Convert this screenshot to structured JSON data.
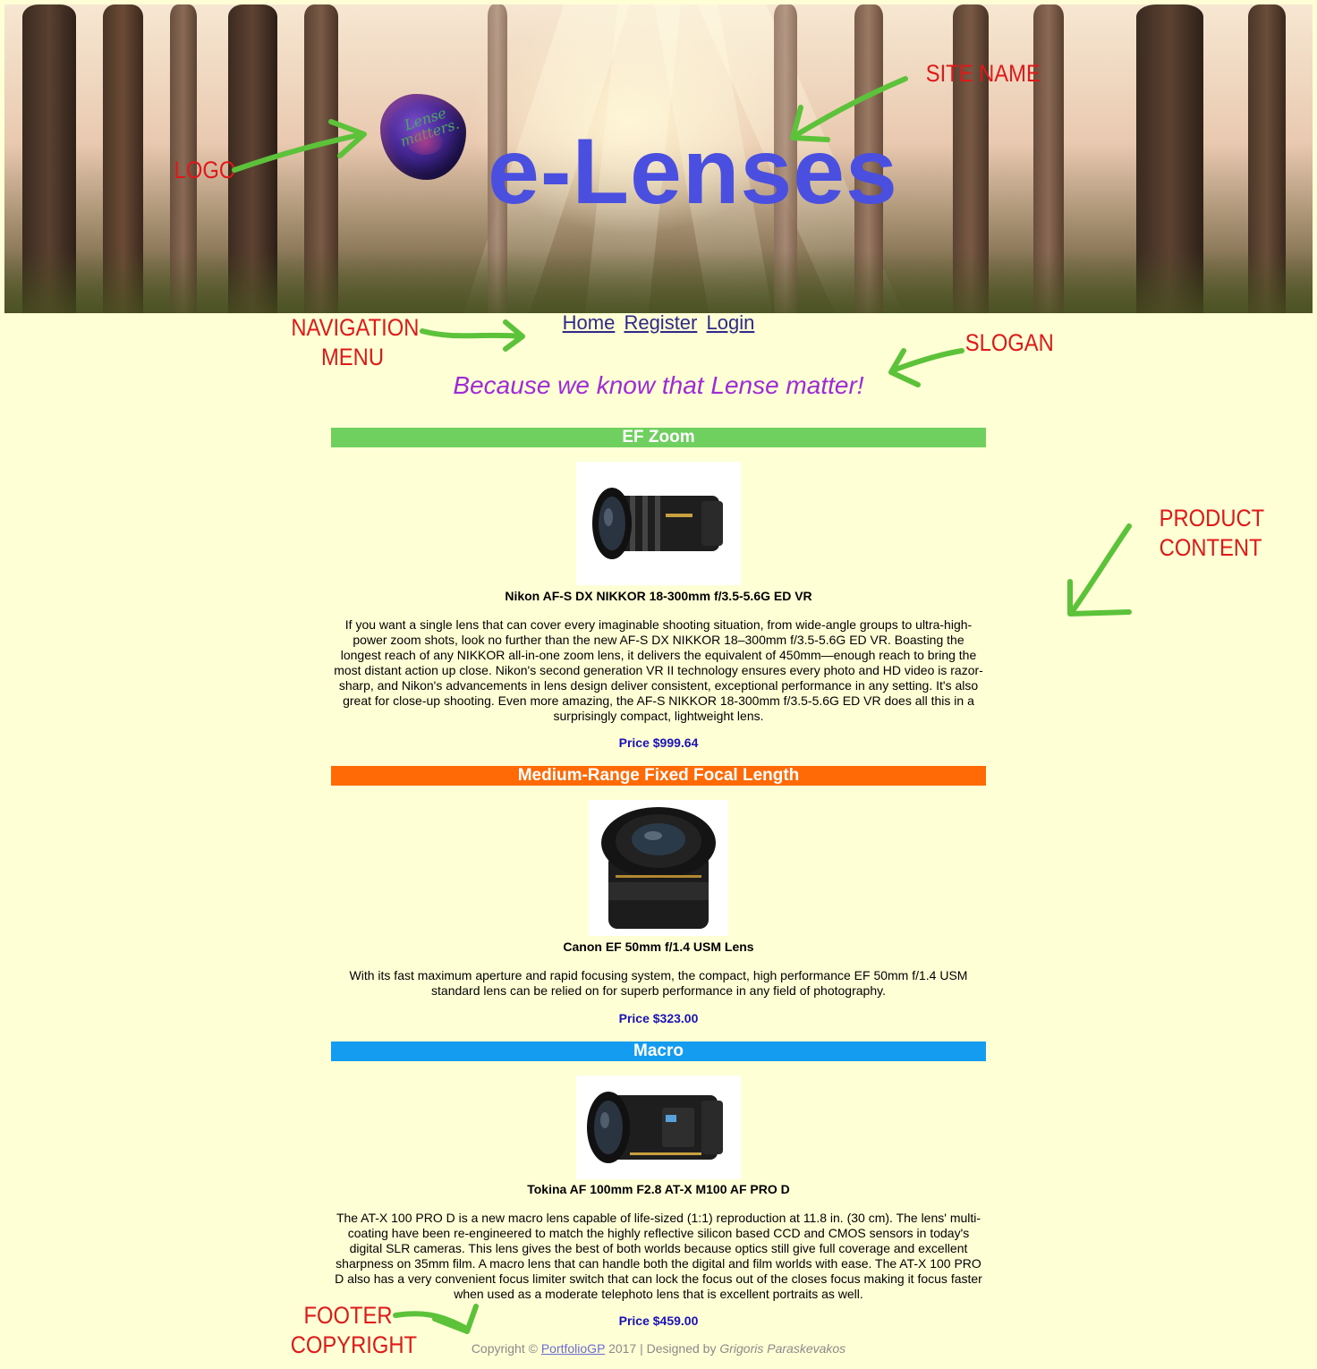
{
  "header": {
    "logo_text": "Lense matters.",
    "site_name": "e-Lenses"
  },
  "annotations": {
    "logo": "LOGO",
    "site_name": "SITE NAME",
    "navigation_menu": "NAVIGATION MENU",
    "slogan": "SLOGAN",
    "product_content": "PRODUCT CONTENT",
    "footer_copyright": "FOOTER COPYRIGHT",
    "arrow_color": "#5cc23a",
    "text_color": "#e01818"
  },
  "nav": {
    "items": [
      {
        "label": "Home"
      },
      {
        "label": "Register"
      },
      {
        "label": "Login"
      }
    ]
  },
  "slogan": "Because we know that Lense matter!",
  "categories": [
    {
      "title": "EF Zoom",
      "color": "#6fcf5f",
      "product": {
        "name": "Nikon AF-S DX NIKKOR 18-300mm f/3.5-5.6G ED VR",
        "description": "If you want a single lens that can cover every imaginable shooting situation, from wide-angle groups to ultra-high-power zoom shots, look no further than the new AF-S DX NIKKOR 18–300mm f/3.5-5.6G ED VR. Boasting the longest reach of any NIKKOR all-in-one zoom lens, it delivers the equivalent of 450mm—enough reach to bring the most distant action up close. Nikon's second generation VR II technology ensures every photo and HD video is razor-sharp, and Nikon's advancements in lens design deliver consistent, exceptional performance in any setting. It's also great for close-up shooting. Even more amazing, the AF-S NIKKOR 18-300mm f/3.5-5.6G ED VR does all this in a surprisingly compact, lightweight lens.",
        "price": "Price $999.64"
      }
    },
    {
      "title": "Medium-Range Fixed Focal Length",
      "color": "#ff6a06",
      "product": {
        "name": "Canon EF 50mm f/1.4 USM Lens",
        "description": "With its fast maximum aperture and rapid focusing system, the compact, high performance EF 50mm f/1.4 USM standard lens can be relied on for superb performance in any field of photography.",
        "price": "Price $323.00"
      }
    },
    {
      "title": "Macro",
      "color": "#149cf0",
      "product": {
        "name": "Tokina AF 100mm F2.8 AT-X M100 AF PRO D",
        "description": "The AT-X 100 PRO D is a new macro lens capable of life-sized (1:1) reproduction at 11.8 in. (30 cm). The lens' multi-coating have been re-engineered to match the highly reflective silicon based CCD and CMOS sensors in today's digital SLR cameras. This lens gives the best of both worlds because optics still give full coverage and excellent sharpness on 35mm film. A macro lens that can handle both the digital and film worlds with ease. The AT-X 100 PRO D also has a very convenient focus limiter switch that can lock the focus out of the closes focus making it focus faster when used as a moderate telephoto lens that is excellent portraits as well.",
        "price": "Price $459.00"
      }
    }
  ],
  "footer": {
    "prefix": "Copyright ©",
    "link": "PortfolioGP",
    "middle": "2017 | Designed by",
    "designer": "Grigoris Paraskevakos"
  }
}
